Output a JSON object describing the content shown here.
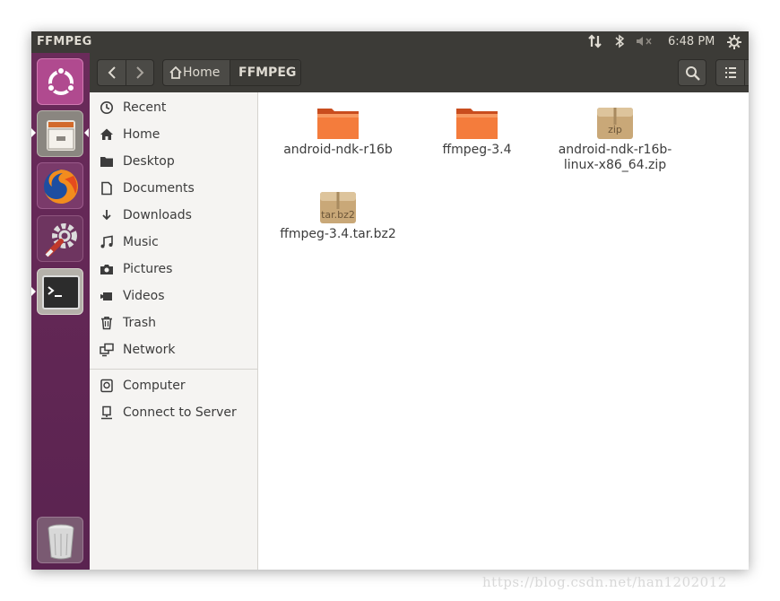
{
  "top_panel": {
    "window_title": "FFMPEG",
    "clock": "6:48 PM",
    "indicators": [
      "network-icon",
      "bluetooth-icon",
      "volume-muted-icon",
      "settings-gear-icon"
    ]
  },
  "launcher": {
    "items": [
      "ubuntu-dash-icon",
      "files-icon",
      "firefox-icon",
      "system-settings-icon",
      "terminal-icon"
    ],
    "trash": "trash-icon"
  },
  "header": {
    "path": [
      {
        "label": "Home"
      },
      {
        "label": "FFMPEG"
      }
    ]
  },
  "sidebar": {
    "places": [
      {
        "label": "Recent",
        "icon": "clock-icon"
      },
      {
        "label": "Home",
        "icon": "home-icon"
      },
      {
        "label": "Desktop",
        "icon": "folder-icon"
      },
      {
        "label": "Documents",
        "icon": "document-icon"
      },
      {
        "label": "Downloads",
        "icon": "download-icon"
      },
      {
        "label": "Music",
        "icon": "music-icon"
      },
      {
        "label": "Pictures",
        "icon": "camera-icon"
      },
      {
        "label": "Videos",
        "icon": "video-icon"
      },
      {
        "label": "Trash",
        "icon": "trash-icon"
      },
      {
        "label": "Network",
        "icon": "network-icon"
      }
    ],
    "other": [
      {
        "label": "Computer",
        "icon": "computer-icon"
      },
      {
        "label": "Connect to Server",
        "icon": "server-icon"
      }
    ]
  },
  "files": [
    {
      "name": "android-ndk-r16b",
      "type": "folder"
    },
    {
      "name": "ffmpeg-3.4",
      "type": "folder"
    },
    {
      "name_line1": "android-ndk-r16b-",
      "name_line2": "linux-x86_64.zip",
      "type": "archive",
      "badge": "zip"
    },
    {
      "name": "ffmpeg-3.4.tar.bz2",
      "type": "archive",
      "badge": "tar.bz2"
    }
  ],
  "watermark": "https://blog.csdn.net/han1202012",
  "colors": {
    "launcher": "#5e2750",
    "panel": "#3c3b37",
    "folder_orange": "#e95420"
  }
}
